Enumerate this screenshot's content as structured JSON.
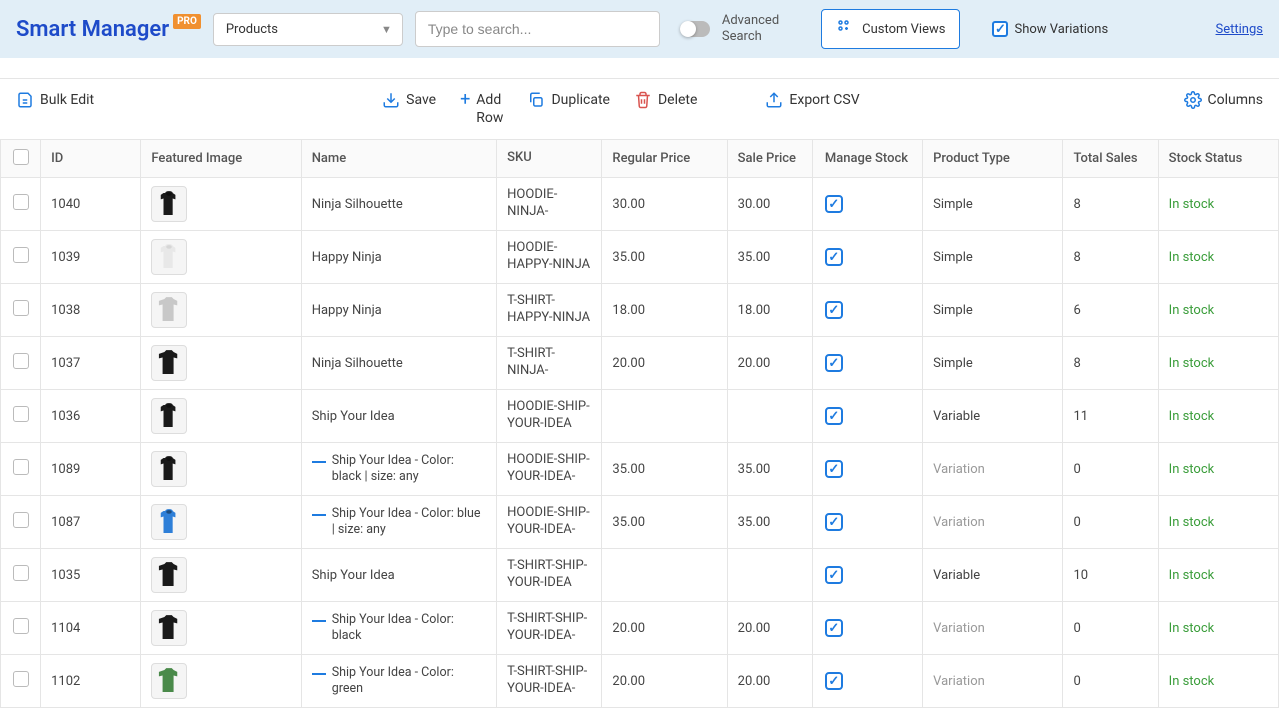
{
  "header": {
    "app_name": "Smart Manager",
    "badge": "PRO",
    "dropdown_value": "Products",
    "search_placeholder": "Type to search...",
    "advanced_search": "Advanced Search",
    "custom_views": "Custom Views",
    "show_variations": "Show Variations",
    "settings": "Settings"
  },
  "toolbar": {
    "bulk_edit": "Bulk Edit",
    "save": "Save",
    "add_row": "Add Row",
    "duplicate": "Duplicate",
    "delete": "Delete",
    "export_csv": "Export CSV",
    "columns": "Columns"
  },
  "columns": {
    "id": "ID",
    "featured_image": "Featured Image",
    "name": "Name",
    "sku": "SKU",
    "regular_price": "Regular Price",
    "sale_price": "Sale Price",
    "manage_stock": "Manage Stock",
    "product_type": "Product Type",
    "total_sales": "Total Sales",
    "stock_status": "Stock Status"
  },
  "rows": [
    {
      "id": "1040",
      "name": "Ninja Silhouette",
      "sku": "HOODIE-NINJA-",
      "reg": "30.00",
      "sale": "30.00",
      "ms": true,
      "ptype": "Simple",
      "sales": "8",
      "stock": "In stock",
      "img": "hoodie-black",
      "variation": false
    },
    {
      "id": "1039",
      "name": "Happy Ninja",
      "sku": "HOODIE-HAPPY-NINJA",
      "reg": "35.00",
      "sale": "35.00",
      "ms": true,
      "ptype": "Simple",
      "sales": "8",
      "stock": "In stock",
      "img": "hoodie-white",
      "variation": false
    },
    {
      "id": "1038",
      "name": "Happy Ninja",
      "sku": "T-SHIRT-HAPPY-NINJA",
      "reg": "18.00",
      "sale": "18.00",
      "ms": true,
      "ptype": "Simple",
      "sales": "6",
      "stock": "In stock",
      "img": "tshirt-grey",
      "variation": false
    },
    {
      "id": "1037",
      "name": "Ninja Silhouette",
      "sku": "T-SHIRT-NINJA-",
      "reg": "20.00",
      "sale": "20.00",
      "ms": true,
      "ptype": "Simple",
      "sales": "8",
      "stock": "In stock",
      "img": "tshirt-black",
      "variation": false
    },
    {
      "id": "1036",
      "name": "Ship Your Idea",
      "sku": "HOODIE-SHIP-YOUR-IDEA",
      "reg": "",
      "sale": "",
      "ms": true,
      "ptype": "Variable",
      "sales": "11",
      "stock": "In stock",
      "img": "hoodie-black",
      "variation": false
    },
    {
      "id": "1089",
      "name": "Ship Your Idea - Color: black | size: any",
      "sku": "HOODIE-SHIP-YOUR-IDEA-",
      "reg": "35.00",
      "sale": "35.00",
      "ms": true,
      "ptype": "Variation",
      "sales": "0",
      "stock": "In stock",
      "img": "hoodie-black",
      "variation": true
    },
    {
      "id": "1087",
      "name": "Ship Your Idea - Color: blue | size: any",
      "sku": "HOODIE-SHIP-YOUR-IDEA-",
      "reg": "35.00",
      "sale": "35.00",
      "ms": true,
      "ptype": "Variation",
      "sales": "0",
      "stock": "In stock",
      "img": "hoodie-blue",
      "variation": true
    },
    {
      "id": "1035",
      "name": "Ship Your Idea",
      "sku": "T-SHIRT-SHIP-YOUR-IDEA",
      "reg": "",
      "sale": "",
      "ms": true,
      "ptype": "Variable",
      "sales": "10",
      "stock": "In stock",
      "img": "tshirt-black",
      "variation": false
    },
    {
      "id": "1104",
      "name": "Ship Your Idea - Color: black",
      "sku": "T-SHIRT-SHIP-YOUR-IDEA-",
      "reg": "20.00",
      "sale": "20.00",
      "ms": true,
      "ptype": "Variation",
      "sales": "0",
      "stock": "In stock",
      "img": "tshirt-black",
      "variation": true
    },
    {
      "id": "1102",
      "name": "Ship Your Idea - Color: green",
      "sku": "T-SHIRT-SHIP-YOUR-IDEA-",
      "reg": "20.00",
      "sale": "20.00",
      "ms": true,
      "ptype": "Variation",
      "sales": "0",
      "stock": "In stock",
      "img": "tshirt-green",
      "variation": true
    }
  ]
}
